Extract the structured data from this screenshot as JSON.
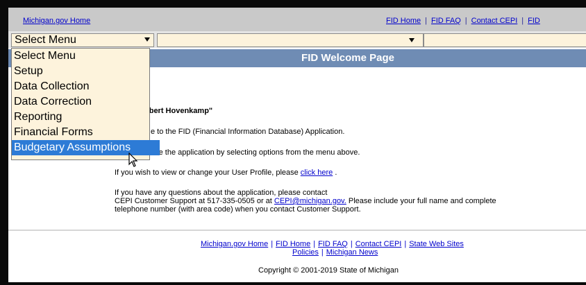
{
  "topnav": {
    "home_link": "Michigan.gov Home",
    "links": [
      "FID Home",
      "FID FAQ",
      "Contact CEPI",
      "FID"
    ]
  },
  "menu": {
    "select1_value": "Select Menu",
    "select2_value": "",
    "select3_value": ""
  },
  "dropdown": {
    "options": [
      "Select Menu",
      "Setup",
      "Data Collection",
      "Data Correction",
      "Reporting",
      "Financial Forms",
      "Budgetary Assumptions"
    ],
    "highlighted": "Budgetary Assumptions"
  },
  "page": {
    "title": "FID Welcome Page"
  },
  "content": {
    "greeting": "obert Hovenkamp\"",
    "intro_fragment": "e to the FID (Financial Information Database) Application.",
    "use_fragment": "use the application by selecting options from the menu above.",
    "profile_prefix": "If you wish to view or change your User Profile, please ",
    "profile_link": "click here",
    "profile_suffix": " .",
    "questions_line1": "If you have any questions about the application, please contact",
    "support_prefix": "CEPI Customer Support at 517-335-0505 or at ",
    "support_email": "CEPI@michigan.gov.",
    "support_suffix": " Please include your full name and complete",
    "support_line3": "telephone number (with area code) when you contact Customer Support."
  },
  "footer": {
    "links_row1": [
      "Michigan.gov Home",
      "FID Home",
      "FID FAQ",
      "Contact CEPI",
      "State Web Sites"
    ],
    "links_row2": [
      "Policies",
      "Michigan News"
    ],
    "copyright": "Copyright © 2001-2019 State of Michigan"
  },
  "colors": {
    "title_bar": "#6f8cb4",
    "select_bg": "#fdf3dc",
    "highlight": "#2d7bd6",
    "link": "#0000cc"
  }
}
